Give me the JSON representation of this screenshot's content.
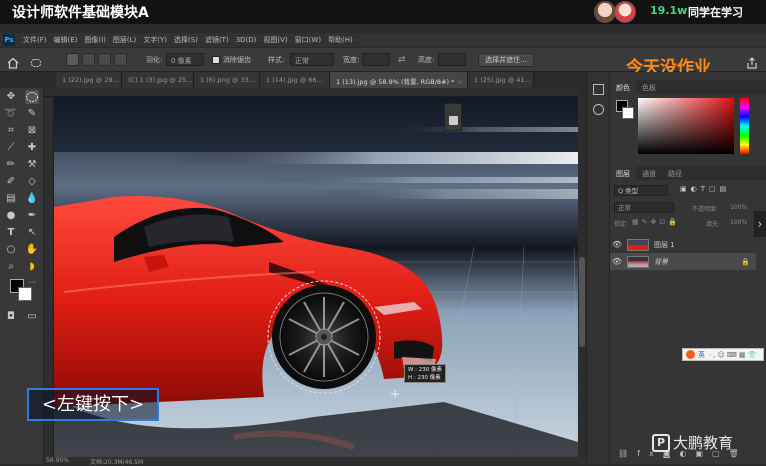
{
  "stream": {
    "title": "设计师软件基础模块A",
    "viewer_count": "19.1w",
    "viewer_label": "同学在学习"
  },
  "app": {
    "logo": "Ps",
    "menus": [
      "文件(F)",
      "编辑(E)",
      "图像(I)",
      "图层(L)",
      "文字(Y)",
      "选择(S)",
      "滤镜(T)",
      "3D(D)",
      "视图(V)",
      "窗口(W)",
      "帮助(H)"
    ]
  },
  "options": {
    "feather_label": "羽化:",
    "feather_value": "0 像素",
    "antialias_label": "消除锯齿",
    "style_label": "样式:",
    "style_value": "正常",
    "width_label": "宽度:",
    "height_label": "高度:",
    "select_mask_label": "选择并遮住..."
  },
  "overlay_text": "今天没作业",
  "tabs": [
    {
      "label": "1 (22).jpg @ 29...",
      "active": false
    },
    {
      "label": "(C) 1 (3).jpg @ 25...",
      "active": false
    },
    {
      "label": "1 (6).png @ 33...",
      "active": false
    },
    {
      "label": "1 (14).jpg @ 66...",
      "active": false
    },
    {
      "label": "1 (13).jpg @ 58.9% (背景, RGB/8#) *",
      "active": true
    },
    {
      "label": "1 (25).jpg @ 41...",
      "active": false
    }
  ],
  "color_panel": {
    "tabs": [
      "颜色",
      "色板"
    ],
    "hue_color": "#e01010"
  },
  "layers_panel": {
    "tabs": [
      "图层",
      "通道",
      "路径"
    ],
    "filter_label": "Q 类型",
    "blend_mode": "正常",
    "opacity_label": "不透明度:",
    "opacity_value": "100%",
    "lock_label": "锁定:",
    "fill_label": "填充:",
    "fill_value": "100%",
    "layers": [
      {
        "name": "图层 1",
        "selected": false
      },
      {
        "name": "背景",
        "selected": true
      }
    ]
  },
  "canvas": {
    "dims_w": "W : 230 像素",
    "dims_h": "H : 230 像素"
  },
  "ime": {
    "label": "英"
  },
  "caption": "<左键按下>",
  "status": {
    "zoom": "58.95%",
    "doc_info": "文档:20.3M/46.5M"
  },
  "watermark": {
    "brand": "大鹏教育"
  },
  "colors": {
    "accent_orange": "#ff8a1c",
    "viewer_green": "#3ddc84",
    "caption_border": "#2e7ce0"
  }
}
